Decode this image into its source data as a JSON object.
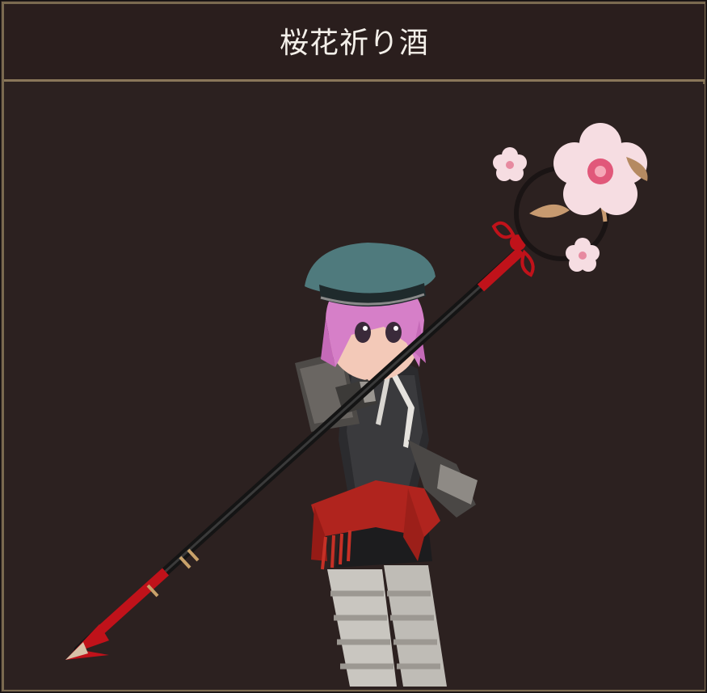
{
  "window": {
    "title": "桜花祈り酒"
  },
  "preview": {
    "subject": "character-with-cherry-blossom-staff",
    "icon_names": [
      "cherry-blossom-staff-icon",
      "character-model"
    ],
    "colors": {
      "background": "#2c2120",
      "frame_gold": "#8a775a",
      "title_text": "#f4f0ea",
      "hat": "#4f7a7d",
      "hair": "#d67fc8",
      "sash": "#b0241e",
      "blossom": "#f6dde2",
      "blossom_center": "#e1587a"
    }
  }
}
